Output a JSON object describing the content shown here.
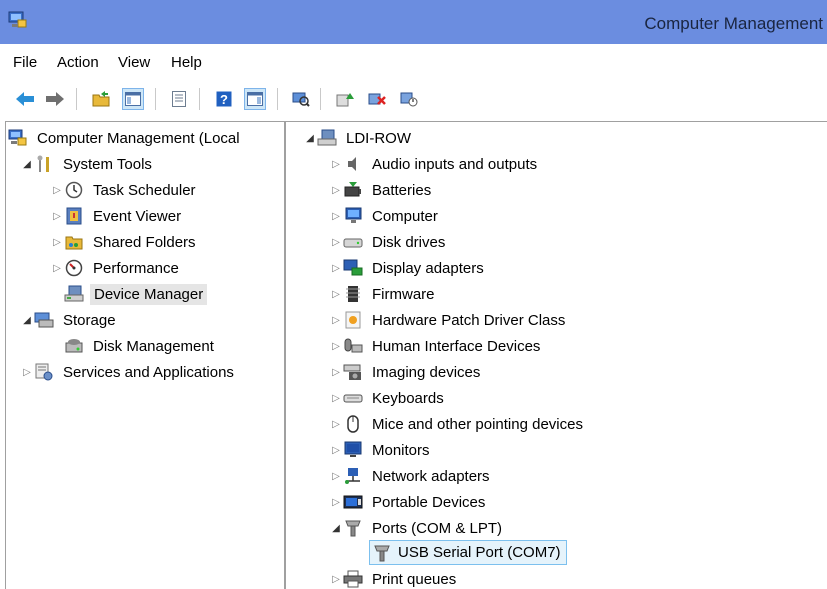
{
  "window": {
    "title": "Computer Management"
  },
  "menu": {
    "items": [
      "File",
      "Action",
      "View",
      "Help"
    ]
  },
  "toolbar": {
    "buttons": [
      {
        "icon": "back-arrow-icon"
      },
      {
        "icon": "forward-arrow-icon"
      },
      {
        "icon": "up-folder-icon"
      },
      {
        "icon": "show-hide-console-tree-icon",
        "active": true
      },
      {
        "icon": "properties-icon"
      },
      {
        "icon": "help-icon"
      },
      {
        "icon": "show-hide-action-pane-icon",
        "active": true
      },
      {
        "icon": "scan-hardware-icon"
      },
      {
        "icon": "update-driver-icon"
      },
      {
        "icon": "uninstall-device-icon"
      },
      {
        "icon": "disable-device-icon"
      }
    ]
  },
  "left_tree": {
    "items": [
      {
        "label": "Computer Management (Local",
        "icon": "computer-management-icon",
        "level": 0,
        "expander": ""
      },
      {
        "label": "System Tools",
        "icon": "system-tools-icon",
        "level": 1,
        "expander": "open"
      },
      {
        "label": "Task Scheduler",
        "icon": "clock-icon",
        "level": 2,
        "expander": "closed"
      },
      {
        "label": "Event Viewer",
        "icon": "event-viewer-icon",
        "level": 2,
        "expander": "closed"
      },
      {
        "label": "Shared Folders",
        "icon": "shared-folders-icon",
        "level": 2,
        "expander": "closed"
      },
      {
        "label": "Performance",
        "icon": "performance-icon",
        "level": 2,
        "expander": "closed"
      },
      {
        "label": "Device Manager",
        "icon": "device-manager-icon",
        "level": 2,
        "expander": "",
        "selected": true
      },
      {
        "label": "Storage",
        "icon": "storage-icon",
        "level": 1,
        "expander": "open"
      },
      {
        "label": "Disk Management",
        "icon": "disk-management-icon",
        "level": 2,
        "expander": ""
      },
      {
        "label": "Services and Applications",
        "icon": "services-icon",
        "level": 1,
        "expander": "closed"
      }
    ]
  },
  "device_tree": {
    "root": {
      "label": "LDI-ROW",
      "icon": "computer-root-icon"
    },
    "categories": [
      {
        "label": "Audio inputs and outputs",
        "icon": "speaker-icon",
        "expander": "closed"
      },
      {
        "label": "Batteries",
        "icon": "battery-icon",
        "expander": "closed"
      },
      {
        "label": "Computer",
        "icon": "monitor-icon",
        "expander": "closed"
      },
      {
        "label": "Disk drives",
        "icon": "disk-drive-icon",
        "expander": "closed"
      },
      {
        "label": "Display adapters",
        "icon": "display-adapter-icon",
        "expander": "closed"
      },
      {
        "label": "Firmware",
        "icon": "firmware-icon",
        "expander": "closed"
      },
      {
        "label": "Hardware Patch Driver Class",
        "icon": "patch-driver-icon",
        "expander": "closed"
      },
      {
        "label": "Human Interface Devices",
        "icon": "hid-icon",
        "expander": "closed"
      },
      {
        "label": "Imaging devices",
        "icon": "camera-icon",
        "expander": "closed"
      },
      {
        "label": "Keyboards",
        "icon": "keyboard-icon",
        "expander": "closed"
      },
      {
        "label": "Mice and other pointing devices",
        "icon": "mouse-icon",
        "expander": "closed"
      },
      {
        "label": "Monitors",
        "icon": "monitor-icon",
        "expander": "closed"
      },
      {
        "label": "Network adapters",
        "icon": "network-icon",
        "expander": "closed"
      },
      {
        "label": "Portable Devices",
        "icon": "portable-device-icon",
        "expander": "closed"
      },
      {
        "label": "Ports (COM & LPT)",
        "icon": "port-icon",
        "expander": "open"
      },
      {
        "label": "USB Serial Port (COM7)",
        "icon": "port-icon",
        "expander": "",
        "child": true,
        "selected": true
      },
      {
        "label": "Print queues",
        "icon": "printer-icon",
        "expander": "closed"
      }
    ]
  },
  "colors": {
    "titlebar": "#6b8de0",
    "selection_blue": "#e5f3fb",
    "selection_border": "#7cc0ee",
    "selection_gray": "#e5e5e5"
  }
}
